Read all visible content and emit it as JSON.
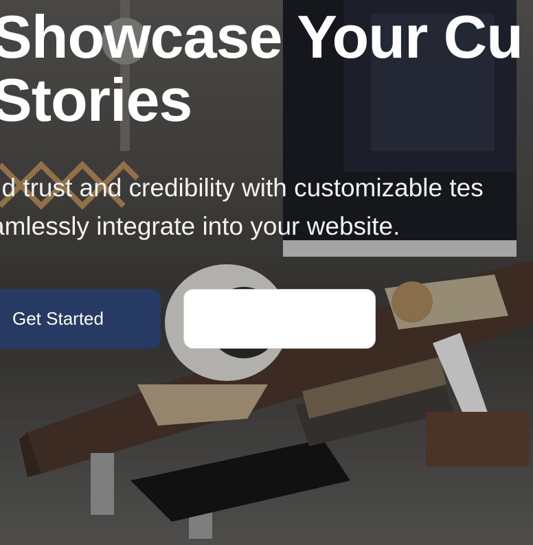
{
  "hero": {
    "title_lines": [
      "Showcase Your Cu",
      "Stories"
    ],
    "subtitle_lines": [
      "ild trust and credibility with customizable tes",
      "amlessly integrate into your website."
    ],
    "primary_button": "Get Started",
    "secondary_button": ""
  },
  "colors": {
    "primary_button_bg": "#263a63",
    "secondary_button_bg": "#ffffff",
    "text": "#ffffff"
  }
}
